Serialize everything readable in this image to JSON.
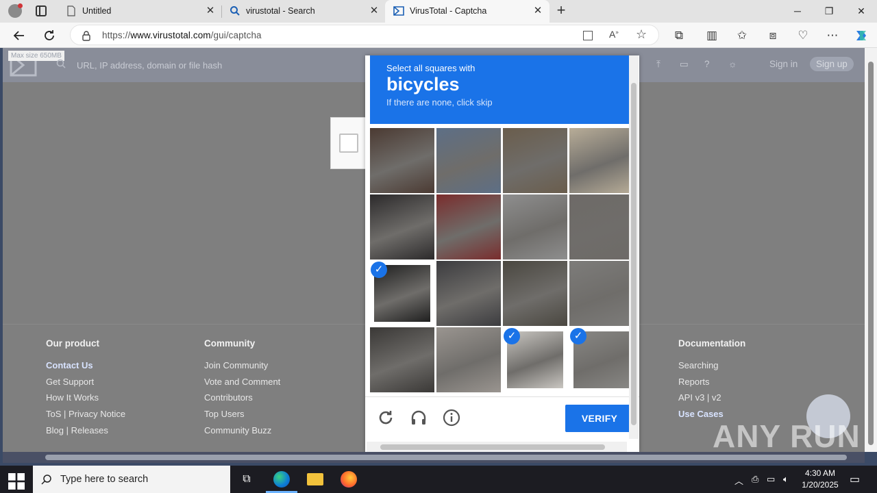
{
  "browser": {
    "tabs": [
      {
        "title": "Untitled"
      },
      {
        "title": "virustotal - Search"
      },
      {
        "title": "VirusTotal - Captcha"
      }
    ],
    "url_prefix": "https://",
    "url_domain": "www.virustotal.com",
    "url_path": "/gui/captcha"
  },
  "page": {
    "search_placeholder": "URL, IP address, domain or file hash",
    "max_size": "Max size 650MB",
    "sign_in": "Sign in",
    "sign_up": "Sign up",
    "footer": {
      "our_product": {
        "heading": "Our product",
        "links": [
          "Contact Us",
          "Get Support",
          "How It Works",
          "ToS | Privacy Notice",
          "Blog | Releases"
        ]
      },
      "community": {
        "heading": "Community",
        "links": [
          "Join Community",
          "Vote and Comment",
          "Contributors",
          "Top Users",
          "Community Buzz"
        ]
      },
      "documentation": {
        "heading": "Documentation",
        "links": [
          "Searching",
          "Reports",
          "API v3 | v2",
          "Use Cases"
        ]
      }
    }
  },
  "captcha": {
    "instruction": "Select all squares with",
    "target": "bicycles",
    "hint": "If there are none, click skip",
    "verify_label": "VERIFY",
    "selected_cells": [
      8,
      14,
      15
    ],
    "accent": "#1a73e8"
  },
  "taskbar": {
    "search_placeholder": "Type here to search",
    "time": "4:30 AM",
    "date": "1/20/2025"
  },
  "watermark": "ANY RUN"
}
